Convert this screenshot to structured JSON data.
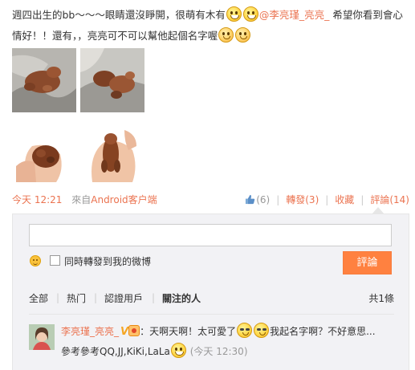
{
  "post": {
    "text_part1": "週四出生的bb～～～眼睛還沒睜開，很萌有木有",
    "mention": "@李亮瑾_亮亮_",
    "text_part2": " 希望你看到會心情好！！還有，，亮亮可不可以幫他起個名字喔",
    "emoji_grin": "grin-emoji",
    "emoji_blush": "blush-emoji"
  },
  "photos": [
    {
      "name": "puppy-photo-1"
    },
    {
      "name": "puppy-photo-2"
    },
    {
      "name": "puppy-photo-3"
    },
    {
      "name": "puppy-photo-4"
    }
  ],
  "meta": {
    "time": "今天 12:21",
    "source_prefix": "來自",
    "source_link": "Android客户端",
    "like_count": "(6)",
    "repost_label": "轉發(3)",
    "favorite_label": "收藏",
    "comment_label": "評論(14)",
    "separator": "|"
  },
  "comment_form": {
    "input_placeholder": "",
    "repost_checkbox_label": "同時轉發到我的微博",
    "submit_label": "評論"
  },
  "filter_tabs": {
    "all": "全部",
    "hot": "热门",
    "verified": "認證用戶",
    "following": "關注的人",
    "total": "共1條",
    "separator": "|"
  },
  "comment": {
    "username": "李亮瑾_亮亮_",
    "vip": "V",
    "text_a": "：天啊天啊！太可愛了",
    "text_b": "我起名字啊？不好意思...",
    "text_c": "參考參考QQ,JJ,KiKi,LaLa",
    "time": "(今天 12:30)"
  },
  "colors": {
    "accent": "#eb7350",
    "submit_bg": "#ff8140",
    "panel_bg": "#f2f2f5"
  }
}
